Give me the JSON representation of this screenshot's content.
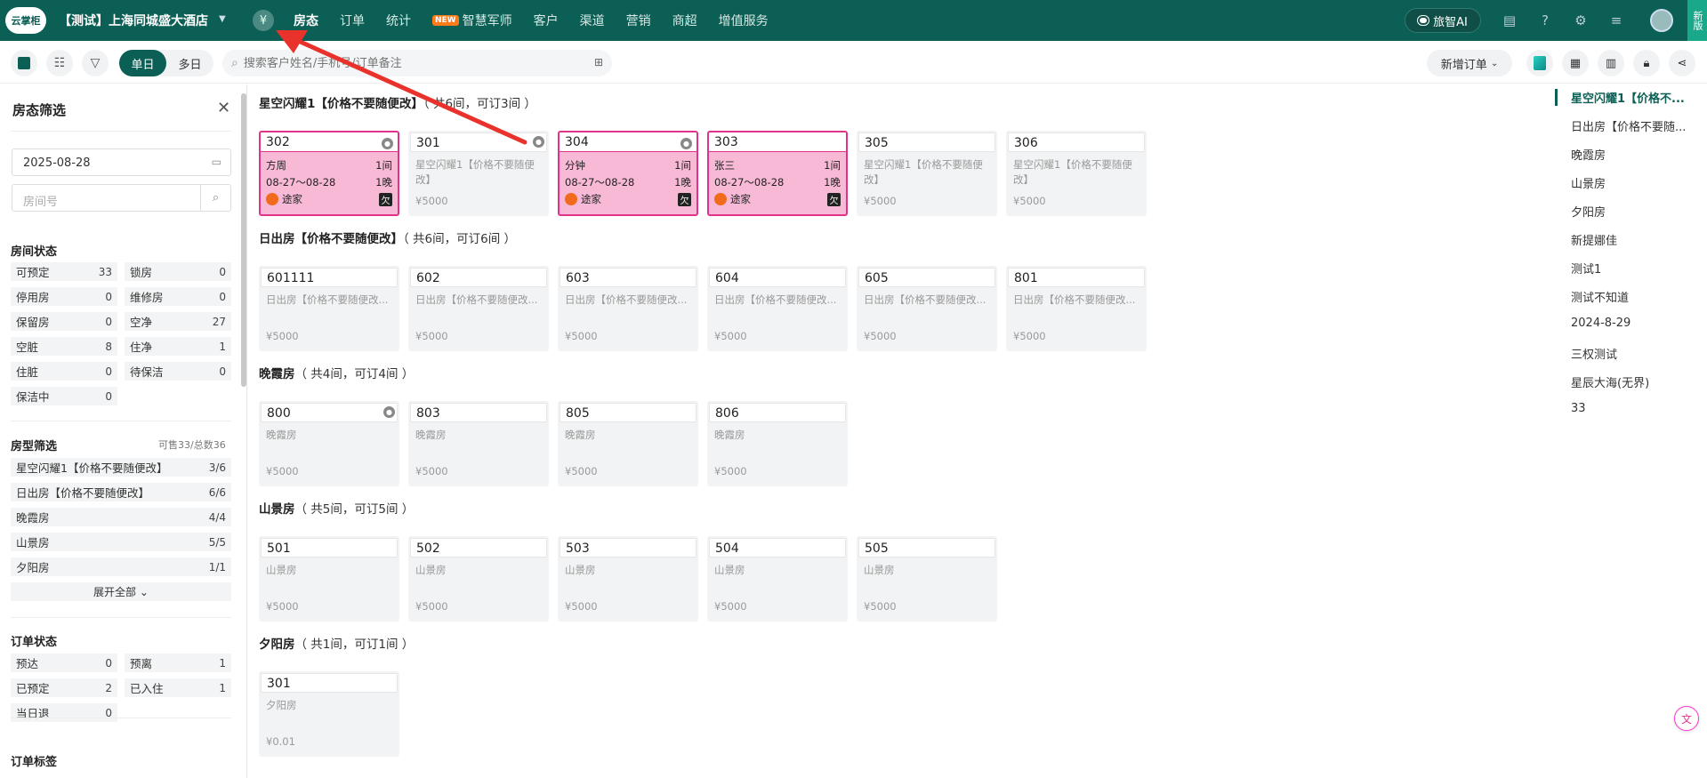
{
  "topbar": {
    "logo": "云掌柜",
    "hotel_name": "【测试】上海同城盛大酒店",
    "yen": "¥",
    "nav": [
      {
        "label": "房态",
        "active": true,
        "badge": ""
      },
      {
        "label": "订单",
        "active": false,
        "badge": ""
      },
      {
        "label": "统计",
        "active": false,
        "badge": ""
      },
      {
        "label": "智慧军师",
        "active": false,
        "badge": "NEW"
      },
      {
        "label": "客户",
        "active": false,
        "badge": ""
      },
      {
        "label": "渠道",
        "active": false,
        "badge": ""
      },
      {
        "label": "营销",
        "active": false,
        "badge": ""
      },
      {
        "label": "商超",
        "active": false,
        "badge": ""
      },
      {
        "label": "增值服务",
        "active": false,
        "badge": ""
      }
    ],
    "ai_label": "旅智AI",
    "new_version": "新版"
  },
  "toolbar": {
    "seg_single": "单日",
    "seg_multi": "多日",
    "search_placeholder": "搜索客户姓名/手机号/订单备注",
    "new_order": "新增订单"
  },
  "sidebar": {
    "title": "房态筛选",
    "date": "2025-08-28",
    "room_placeholder": "房间号",
    "room_status_title": "房间状态",
    "room_status": [
      {
        "label": "可预定",
        "n": "33"
      },
      {
        "label": "锁房",
        "n": "0"
      },
      {
        "label": "停用房",
        "n": "0"
      },
      {
        "label": "维修房",
        "n": "0"
      },
      {
        "label": "保留房",
        "n": "0"
      },
      {
        "label": "空净",
        "n": "27"
      },
      {
        "label": "空脏",
        "n": "8"
      },
      {
        "label": "住净",
        "n": "1"
      },
      {
        "label": "住脏",
        "n": "0"
      },
      {
        "label": "待保洁",
        "n": "0"
      },
      {
        "label": "保洁中",
        "n": "0"
      }
    ],
    "room_type_title": "房型筛选",
    "room_type_summary": "可售33/总数36",
    "room_types": [
      {
        "label": "星空闪耀1【价格不要随便改】",
        "n": "3/6"
      },
      {
        "label": "日出房【价格不要随便改】",
        "n": "6/6"
      },
      {
        "label": "晚霞房",
        "n": "4/4"
      },
      {
        "label": "山景房",
        "n": "5/5"
      },
      {
        "label": "夕阳房",
        "n": "1/1"
      }
    ],
    "expand_all": "展开全部",
    "order_status_title": "订单状态",
    "order_status": [
      {
        "label": "预达",
        "n": "0"
      },
      {
        "label": "预离",
        "n": "1"
      },
      {
        "label": "已预定",
        "n": "2"
      },
      {
        "label": "已入住",
        "n": "1"
      },
      {
        "label": "当日退",
        "n": "0"
      }
    ],
    "order_tag_title": "订单标签"
  },
  "groups": [
    {
      "title": "星空闪耀1【价格不要随便改】",
      "count": "（ 共6间，可订3间 ）",
      "rooms": [
        {
          "num": "302",
          "occupied": true,
          "guest": "方周",
          "rooms": "1间",
          "dates": "08-27～08-28",
          "nights": "1晚",
          "source": "途家",
          "owe": "欠",
          "lock": true
        },
        {
          "num": "301",
          "occupied": false,
          "desc": "星空闪耀1【价格不要随便改】",
          "price": "¥5000",
          "lock": true
        },
        {
          "num": "304",
          "occupied": true,
          "guest": "分钟",
          "rooms": "1间",
          "dates": "08-27～08-28",
          "nights": "1晚",
          "source": "途家",
          "owe": "欠",
          "lock": true
        },
        {
          "num": "303",
          "occupied": true,
          "guest": "张三",
          "rooms": "1间",
          "dates": "08-27～08-28",
          "nights": "1晚",
          "source": "途家",
          "owe": "欠",
          "lock": false
        },
        {
          "num": "305",
          "occupied": false,
          "desc": "星空闪耀1【价格不要随便改】",
          "price": "¥5000",
          "lock": false
        },
        {
          "num": "306",
          "occupied": false,
          "desc": "星空闪耀1【价格不要随便改】",
          "price": "¥5000",
          "lock": false
        }
      ]
    },
    {
      "title": "日出房【价格不要随便改】",
      "count": "（ 共6间，可订6间 ）",
      "rooms": [
        {
          "num": "601111",
          "occupied": false,
          "desc": "日出房【价格不要随便改...",
          "price": "¥5000",
          "lock": false
        },
        {
          "num": "602",
          "occupied": false,
          "desc": "日出房【价格不要随便改...",
          "price": "¥5000",
          "lock": false
        },
        {
          "num": "603",
          "occupied": false,
          "desc": "日出房【价格不要随便改...",
          "price": "¥5000",
          "lock": false
        },
        {
          "num": "604",
          "occupied": false,
          "desc": "日出房【价格不要随便改...",
          "price": "¥5000",
          "lock": false
        },
        {
          "num": "605",
          "occupied": false,
          "desc": "日出房【价格不要随便改...",
          "price": "¥5000",
          "lock": false
        },
        {
          "num": "801",
          "occupied": false,
          "desc": "日出房【价格不要随便改...",
          "price": "¥5000",
          "lock": false
        }
      ]
    },
    {
      "title": "晚霞房",
      "count": "（ 共4间，可订4间 ）",
      "rooms": [
        {
          "num": "800",
          "occupied": false,
          "desc": "晚霞房",
          "price": "¥5000",
          "lock": true
        },
        {
          "num": "803",
          "occupied": false,
          "desc": "晚霞房",
          "price": "¥5000",
          "lock": false
        },
        {
          "num": "805",
          "occupied": false,
          "desc": "晚霞房",
          "price": "¥5000",
          "lock": false
        },
        {
          "num": "806",
          "occupied": false,
          "desc": "晚霞房",
          "price": "¥5000",
          "lock": false
        }
      ]
    },
    {
      "title": "山景房",
      "count": "（ 共5间，可订5间 ）",
      "rooms": [
        {
          "num": "501",
          "occupied": false,
          "desc": "山景房",
          "price": "¥5000",
          "lock": false
        },
        {
          "num": "502",
          "occupied": false,
          "desc": "山景房",
          "price": "¥5000",
          "lock": false
        },
        {
          "num": "503",
          "occupied": false,
          "desc": "山景房",
          "price": "¥5000",
          "lock": false
        },
        {
          "num": "504",
          "occupied": false,
          "desc": "山景房",
          "price": "¥5000",
          "lock": false
        },
        {
          "num": "505",
          "occupied": false,
          "desc": "山景房",
          "price": "¥5000",
          "lock": false
        }
      ]
    },
    {
      "title": "夕阳房",
      "count": "（ 共1间，可订1间 ）",
      "rooms": [
        {
          "num": "301",
          "occupied": false,
          "desc": "夕阳房",
          "price": "¥0.01",
          "lock": false
        }
      ]
    }
  ],
  "anchors": [
    {
      "label": "星空闪耀1【价格不...",
      "active": true
    },
    {
      "label": "日出房【价格不要随...",
      "active": false
    },
    {
      "label": "晚霞房",
      "active": false
    },
    {
      "label": "山景房",
      "active": false
    },
    {
      "label": "夕阳房",
      "active": false
    },
    {
      "label": "新提娜佳",
      "active": false
    },
    {
      "label": "测试1",
      "active": false
    },
    {
      "label": "测试不知道",
      "active": false
    },
    {
      "label": "2024-8-29",
      "active": false
    },
    {
      "label": "三权测试",
      "active": false
    },
    {
      "label": "星辰大海(无界)",
      "active": false
    },
    {
      "label": "33",
      "active": false
    }
  ],
  "colors": {
    "brand": "#0b5f55",
    "occupied_bg": "#f7b9d6",
    "occupied_border": "#e0348a",
    "arrow": "#e8322b"
  }
}
